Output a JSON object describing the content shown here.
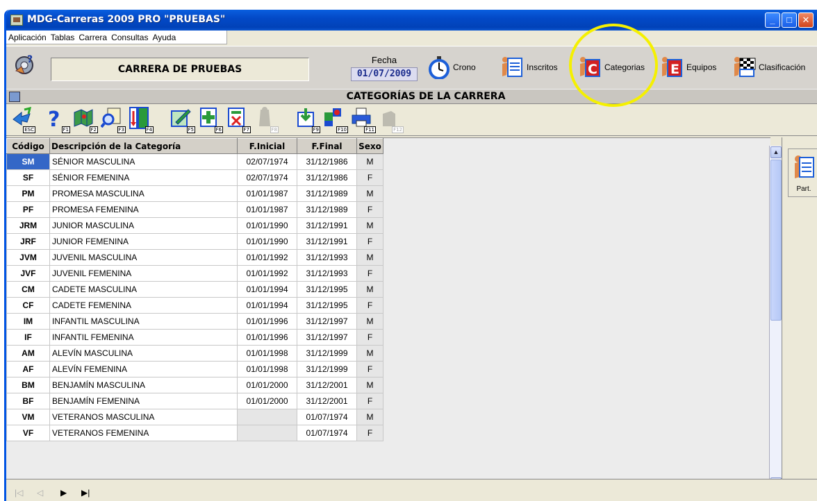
{
  "window": {
    "title": "MDG-Carreras 2009 PRO \"PRUEBAS\"",
    "min_glyph": "_",
    "max_glyph": "□",
    "close_glyph": "✕"
  },
  "menu": [
    "Aplicación",
    "Tablas",
    "Carrera",
    "Consultas",
    "Ayuda"
  ],
  "header": {
    "race_name": "CARRERA DE PRUEBAS",
    "fecha_label": "Fecha",
    "fecha_value": "01/07/2009",
    "buttons": {
      "crono": "Crono",
      "inscritos": "Inscritos",
      "categorias": "Categorias",
      "equipos": "Equipos",
      "clasificacion": "Clasificación"
    }
  },
  "section_title": "CATEGORÍAS DE LA CARRERA",
  "toolbar": {
    "keys": [
      "ESC",
      "F1",
      "F2",
      "F3",
      "F4",
      "F5",
      "F6",
      "F7",
      "F8",
      "F9",
      "F10",
      "F11",
      "F12"
    ]
  },
  "table": {
    "headers": [
      "Código",
      "Descripción de la Categoría",
      "F.Inicial",
      "F.Final",
      "Sexo"
    ],
    "rows": [
      {
        "code": "SM",
        "desc": "SÉNIOR MASCULINA",
        "start": "02/07/1974",
        "end": "31/12/1986",
        "sex": "M"
      },
      {
        "code": "SF",
        "desc": "SÉNIOR FEMENINA",
        "start": "02/07/1974",
        "end": "31/12/1986",
        "sex": "F"
      },
      {
        "code": "PM",
        "desc": "PROMESA MASCULINA",
        "start": "01/01/1987",
        "end": "31/12/1989",
        "sex": "M"
      },
      {
        "code": "PF",
        "desc": "PROMESA FEMENINA",
        "start": "01/01/1987",
        "end": "31/12/1989",
        "sex": "F"
      },
      {
        "code": "JRM",
        "desc": "JUNIOR MASCULINA",
        "start": "01/01/1990",
        "end": "31/12/1991",
        "sex": "M"
      },
      {
        "code": "JRF",
        "desc": "JUNIOR FEMENINA",
        "start": "01/01/1990",
        "end": "31/12/1991",
        "sex": "F"
      },
      {
        "code": "JVM",
        "desc": "JUVENIL MASCULINA",
        "start": "01/01/1992",
        "end": "31/12/1993",
        "sex": "M"
      },
      {
        "code": "JVF",
        "desc": "JUVENIL FEMENINA",
        "start": "01/01/1992",
        "end": "31/12/1993",
        "sex": "F"
      },
      {
        "code": "CM",
        "desc": "CADETE MASCULINA",
        "start": "01/01/1994",
        "end": "31/12/1995",
        "sex": "M"
      },
      {
        "code": "CF",
        "desc": "CADETE FEMENINA",
        "start": "01/01/1994",
        "end": "31/12/1995",
        "sex": "F"
      },
      {
        "code": "IM",
        "desc": "INFANTIL MASCULINA",
        "start": "01/01/1996",
        "end": "31/12/1997",
        "sex": "M"
      },
      {
        "code": "IF",
        "desc": "INFANTIL FEMENINA",
        "start": "01/01/1996",
        "end": "31/12/1997",
        "sex": "F"
      },
      {
        "code": "AM",
        "desc": "ALEVÍN MASCULINA",
        "start": "01/01/1998",
        "end": "31/12/1999",
        "sex": "M"
      },
      {
        "code": "AF",
        "desc": "ALEVÍN FEMENINA",
        "start": "01/01/1998",
        "end": "31/12/1999",
        "sex": "F"
      },
      {
        "code": "BM",
        "desc": "BENJAMÍN MASCULINA",
        "start": "01/01/2000",
        "end": "31/12/2001",
        "sex": "M"
      },
      {
        "code": "BF",
        "desc": "BENJAMÍN FEMENINA",
        "start": "01/01/2000",
        "end": "31/12/2001",
        "sex": "F"
      },
      {
        "code": "VM",
        "desc": "VETERANOS MASCULINA",
        "start": "",
        "end": "01/07/1974",
        "sex": "M"
      },
      {
        "code": "VF",
        "desc": "VETERANOS FEMENINA",
        "start": "",
        "end": "01/07/1974",
        "sex": "F"
      }
    ]
  },
  "right_panel": {
    "part_label": "Part."
  },
  "bottom_nav": {
    "first": "|◁",
    "prev": "◁",
    "next": "▶",
    "last": "▶|"
  },
  "colors": {
    "selected_row": "#3467c7",
    "highlight_circle": "#f5f000",
    "titlebar": "#0349c7"
  }
}
